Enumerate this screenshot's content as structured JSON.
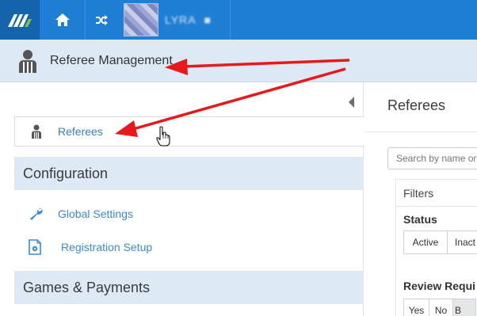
{
  "topbar": {
    "logo_icon": "app-logo-icon",
    "home_icon": "home-icon",
    "switch_icon": "shuffle-icon",
    "org_name": "LYRA",
    "org_suffix": "■",
    "colors": {
      "bar": "#1e7fd4",
      "logo_bg": "#1464ad"
    }
  },
  "header": {
    "title": "Referee Management",
    "icon": "referee-icon"
  },
  "left_panel": {
    "collapse_icon": "collapse-left-icon",
    "active_item": {
      "label": "Referees",
      "icon": "referee-icon"
    },
    "sections": [
      {
        "title": "Configuration",
        "links": [
          {
            "label": "Global Settings",
            "icon": "wrench-icon"
          },
          {
            "label": "Registration Setup",
            "icon": "settings-document-icon"
          }
        ]
      },
      {
        "title": "Games & Payments",
        "links": []
      }
    ]
  },
  "right_panel": {
    "title": "Referees",
    "search": {
      "placeholder": "Search by name or",
      "value": ""
    },
    "filters": {
      "heading": "Filters",
      "status": {
        "label": "Status",
        "options": [
          "Active",
          "Inact"
        ]
      },
      "review": {
        "label": "Review Requi",
        "options": [
          "Yes",
          "No",
          "B"
        ]
      }
    }
  },
  "annotations": {
    "arrow_color": "#e8191a",
    "cursor_icon": "hand-pointer-icon"
  }
}
